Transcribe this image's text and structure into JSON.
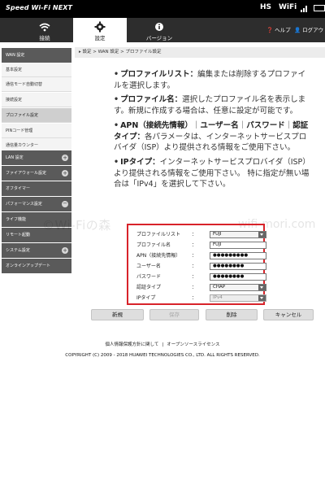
{
  "status_bar": {
    "brand": "Speed Wi-Fi NEXT",
    "hs": "HS",
    "wifi": "WiFi"
  },
  "nav": {
    "tabs": [
      {
        "label": "接続",
        "icon": "wifi-icon"
      },
      {
        "label": "設定",
        "icon": "gear-icon"
      },
      {
        "label": "バージョン",
        "icon": "info-icon"
      }
    ],
    "help": "ヘルプ",
    "logout": "ログアウ"
  },
  "sidebar": {
    "items": [
      {
        "label": "WAN 設定"
      },
      {
        "label": "基本設定"
      },
      {
        "label": "通信モード自動切替"
      },
      {
        "label": "接続設定"
      },
      {
        "label": "プロファイル設定"
      },
      {
        "label": "PINコード管理"
      },
      {
        "label": "通信量カウンター"
      },
      {
        "label": "LAN 設定"
      },
      {
        "label": "ファイアウォール設定"
      },
      {
        "label": "オフタイマー"
      },
      {
        "label": "パフォーマンス設定"
      },
      {
        "label": "ライフ機能"
      },
      {
        "label": "リモート起動"
      },
      {
        "label": "システム設定"
      },
      {
        "label": "オンラインアップデート"
      }
    ]
  },
  "breadcrumb": "設定 > WAN 設定 > プロファイル設定",
  "description": {
    "p1_term": "プロファイルリスト：",
    "p1_text": "編集または削除するプロファイルを選択します。",
    "p2_term": "プロファイル名：",
    "p2_text": "選択したプロファイル名を表示します。新規に作成する場合は、任意に設定が可能です。",
    "p3_term_a": "APN（接続先情報）",
    "p3_sep1": "｜",
    "p3_term_b": "ユーザー名",
    "p3_sep2": "｜",
    "p3_term_c": "パスワード",
    "p3_sep3": "｜",
    "p3_term_d": "認証タイプ：",
    "p3_text": "各パラメータは、インターネットサービスプロバイダ（ISP）より提供される情報をご使用下さい。",
    "p4_term": "IPタイプ：",
    "p4_text": "インターネットサービスプロバイダ（ISP）より提供される情報をご使用下さい。 特に指定が無い場合は「IPv4」を選択して下さい。"
  },
  "watermark": "©Wi-Fiの森",
  "watermark_url": "wifi-mori.com",
  "form": {
    "fields": [
      {
        "label": "プロファイルリスト",
        "value": "FUJI",
        "type": "select"
      },
      {
        "label": "プロファイル名",
        "value": "FUJI",
        "type": "text"
      },
      {
        "label": "APN（接続先情報）",
        "value": "●●●●●●●●●",
        "type": "password"
      },
      {
        "label": "ユーザー名",
        "value": "●●●●●●●●",
        "type": "password"
      },
      {
        "label": "パスワード",
        "value": "●●●●●●●●",
        "type": "password"
      },
      {
        "label": "認証タイプ",
        "value": "CHAP",
        "type": "select"
      },
      {
        "label": "IPタイプ",
        "value": "IPv4",
        "type": "select-disabled"
      }
    ],
    "colon": "："
  },
  "buttons": {
    "new": "新規",
    "save": "保存",
    "delete": "削除",
    "cancel": "キャンセル"
  },
  "footer": {
    "privacy": "個人情報保護方針に関して",
    "sep": "|",
    "oss": "オープンソースライセンス",
    "copyright": "COPYRIGHT (C) 2009 - 2018 HUAWEI TECHNOLOGIES CO., LTD. ALL RIGHTS RESERVED."
  },
  "colors": {
    "highlight_border": "#d8232a",
    "nav_bg": "#2d2d2d",
    "sidebar_dark": "#5a5a5a"
  }
}
